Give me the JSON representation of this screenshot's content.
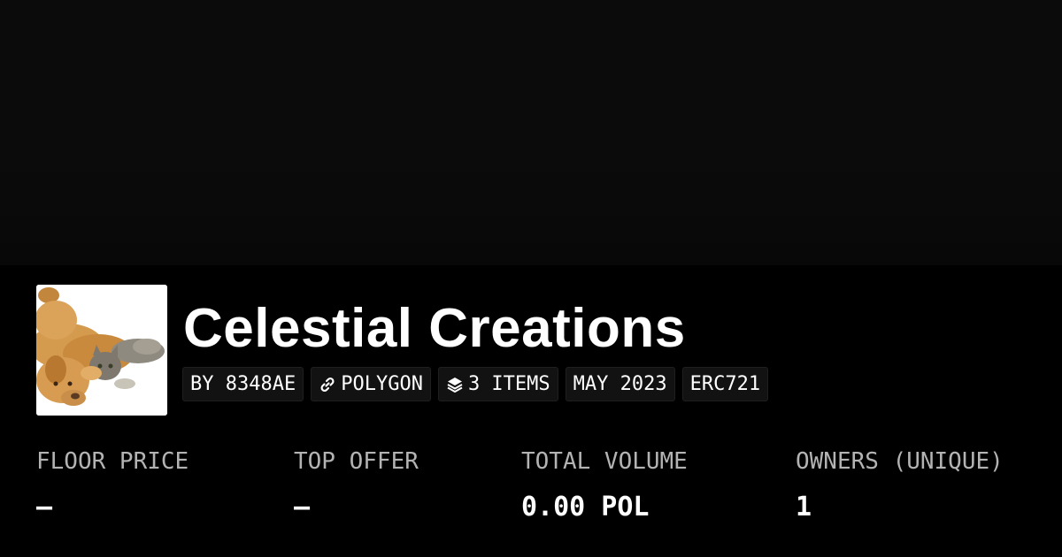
{
  "collection": {
    "title": "Celestial Creations",
    "avatar_icon": "dog-and-cat-image"
  },
  "chips": [
    {
      "label": "BY 8348AE",
      "icon": ""
    },
    {
      "label": "POLYGON",
      "icon": "link-chain-icon"
    },
    {
      "label": "3 ITEMS",
      "icon": "layers-icon"
    },
    {
      "label": "MAY 2023",
      "icon": ""
    },
    {
      "label": "ERC721",
      "icon": ""
    }
  ],
  "stats": [
    {
      "label": "FLOOR PRICE",
      "value": "–"
    },
    {
      "label": "TOP OFFER",
      "value": "–"
    },
    {
      "label": "TOTAL VOLUME",
      "value": "0.00 POL"
    },
    {
      "label": "OWNERS (UNIQUE)",
      "value": "1"
    }
  ],
  "colors": {
    "background": "#000000",
    "chip_background": "#121212",
    "label_gray": "#b3b3b3",
    "text": "#ffffff"
  }
}
